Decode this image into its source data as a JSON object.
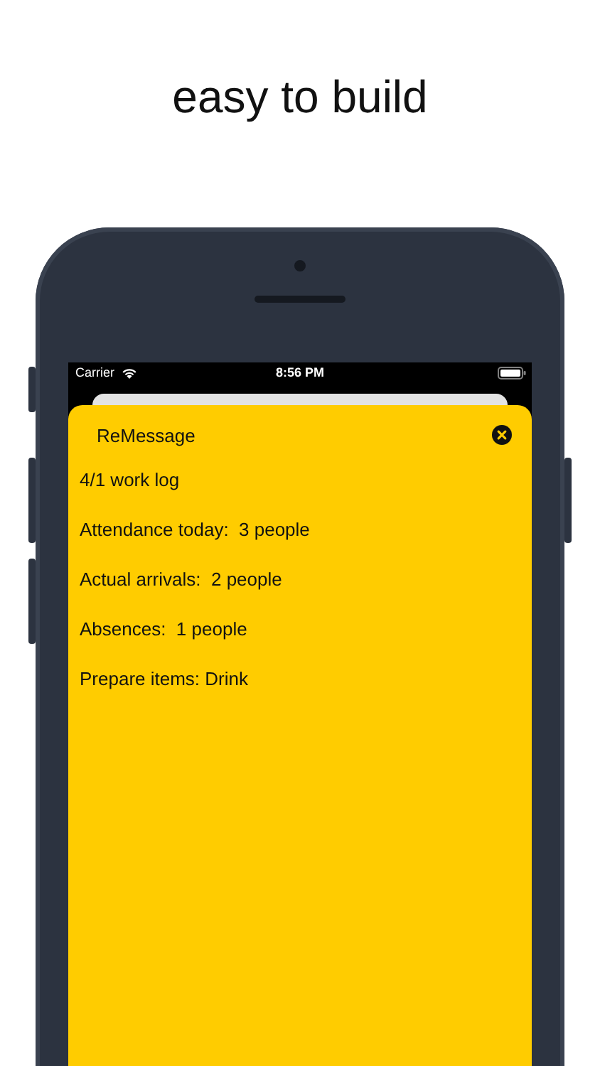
{
  "headline": "easy to build",
  "status_bar": {
    "carrier": "Carrier",
    "time": "8:56 PM"
  },
  "sheet": {
    "title": "ReMessage",
    "lines": [
      "4/1 work log",
      "Attendance today:  3 people",
      "Actual arrivals:  2 people",
      "Absences:  1 people",
      "Prepare items: Drink"
    ]
  }
}
